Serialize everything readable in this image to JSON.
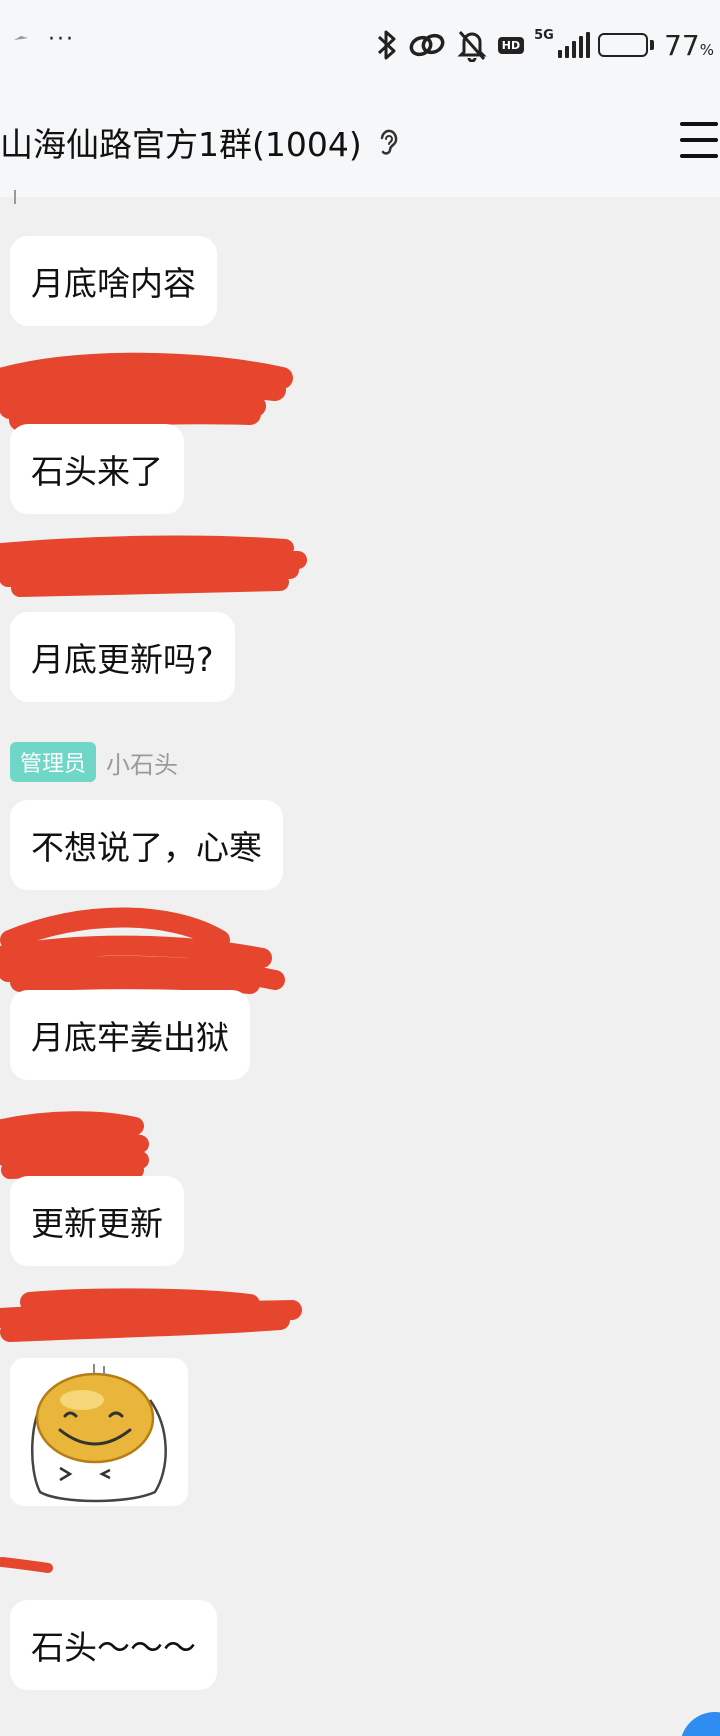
{
  "status_bar": {
    "dots": "···",
    "battery_value": "77",
    "battery_unit": "%",
    "network_label": "5G",
    "hd_label": "HD",
    "icons": [
      "bluetooth-icon",
      "link-icon",
      "mute-bell-icon",
      "hd-icon",
      "signal-5g-icon",
      "battery-icon"
    ]
  },
  "header": {
    "title": "山海仙路官方1群(1004)",
    "ear_icon": "ear-icon",
    "menu_icon": "hamburger-menu-icon"
  },
  "messages": [
    {
      "text": "月底啥内容"
    },
    {
      "text": "石头来了"
    },
    {
      "text": "月底更新吗?"
    },
    {
      "text": "不想说了，心寒"
    },
    {
      "text": "月底牢姜出狱"
    },
    {
      "text": "更新更新"
    },
    {
      "text": "石头～～～"
    }
  ],
  "admin_sender": {
    "role": "管理员",
    "name": "小石头"
  },
  "sticker": {
    "icon": "smiley-sticker-icon"
  },
  "colors": {
    "background": "#f0f0f0",
    "header_background": "#f6f7f8",
    "bubble": "#ffffff",
    "admin_badge": "#6fd6c8",
    "redaction": "#e5462d",
    "fab": "#2f8cf0"
  }
}
